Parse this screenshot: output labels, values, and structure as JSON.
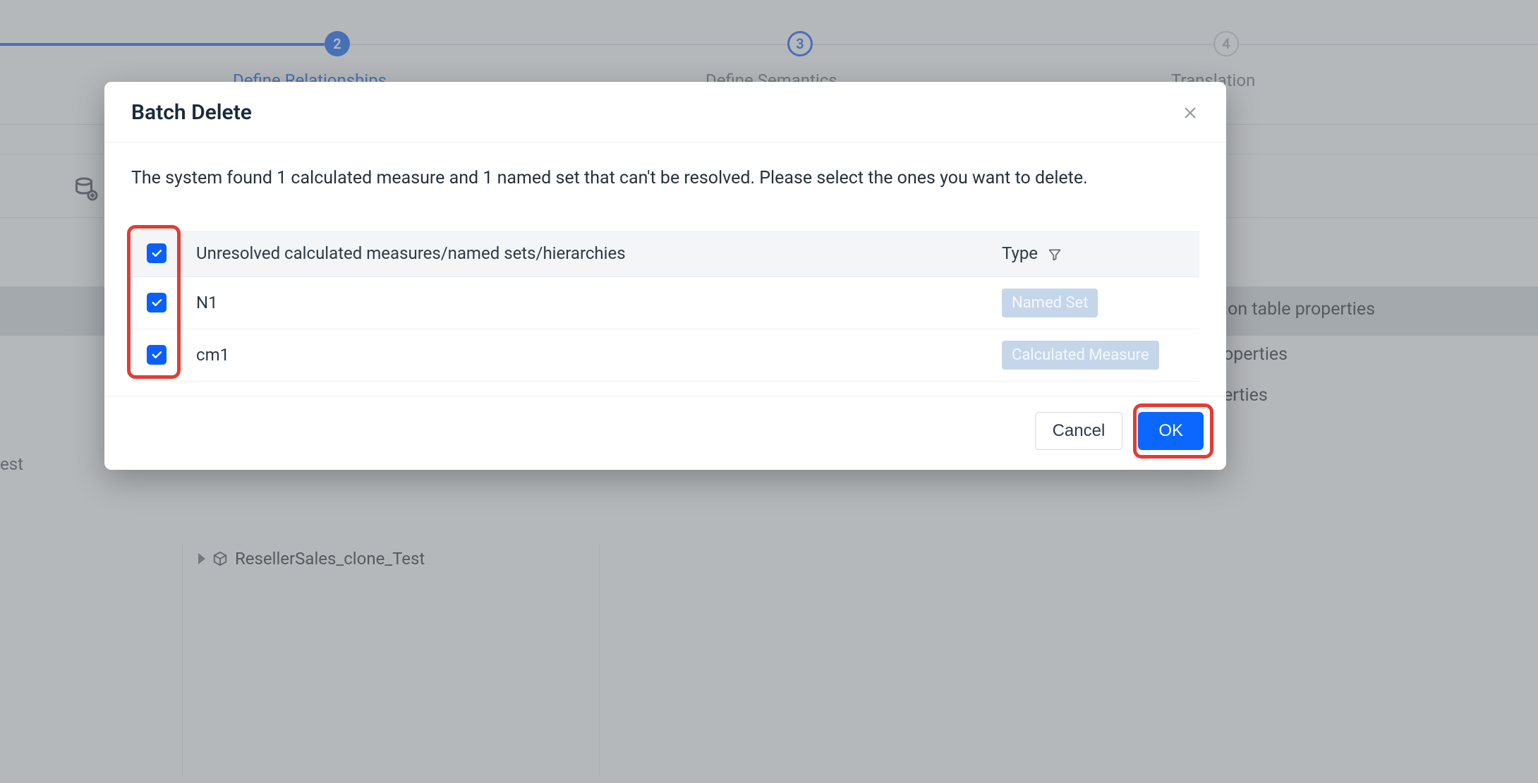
{
  "stepper": {
    "step2": "2",
    "step3": "3",
    "step4": "4",
    "label2": "Define Relationships",
    "label3": "Define Semantics",
    "label4": "Translation"
  },
  "bg": {
    "left_text": "est",
    "tree_item": "ResellerSales_clone_Test",
    "right_lines": {
      "r1": "ion table properties",
      "r2": "operties",
      "r3": "erties"
    }
  },
  "dialog": {
    "title": "Batch Delete",
    "intro": "The system found 1 calculated measure and 1 named set that can't be resolved. Please select the ones you want to delete.",
    "columns": {
      "chk": "",
      "name": "Unresolved calculated measures/named sets/hierarchies",
      "type": "Type"
    },
    "rows": [
      {
        "name": "N1",
        "type": "Named Set",
        "pill_class": "named",
        "checked": true
      },
      {
        "name": "cm1",
        "type": "Calculated Measure",
        "pill_class": "calc",
        "checked": true
      }
    ],
    "buttons": {
      "cancel": "Cancel",
      "ok": "OK"
    }
  }
}
